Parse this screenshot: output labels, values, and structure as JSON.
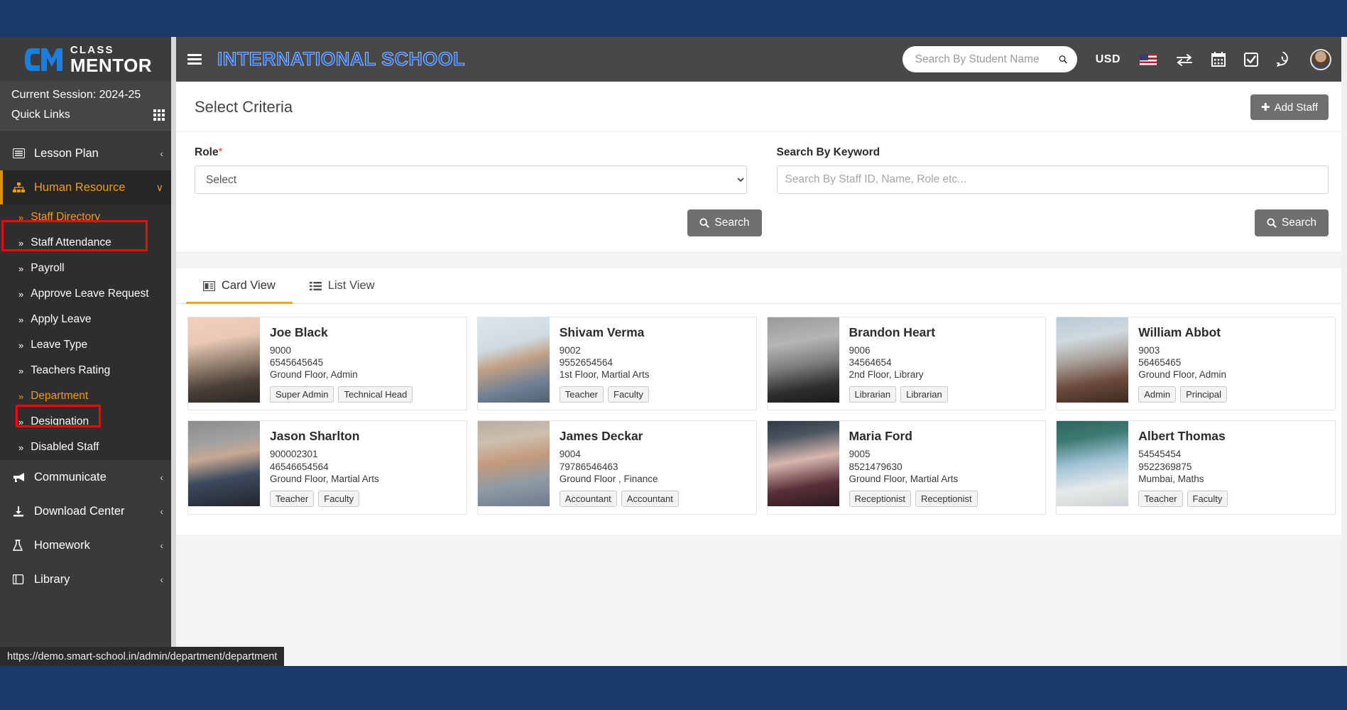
{
  "brand": {
    "top_word": "CLASS",
    "bottom_word": "MENTOR",
    "logo_icon": "cm-monogram-icon"
  },
  "sidebar": {
    "session_label": "Current Session: 2024-25",
    "quick_links_label": "Quick Links",
    "quick_links_icon": "grid-icon",
    "items": [
      {
        "label": "Lesson Plan",
        "icon": "lesson-plan-icon",
        "caret": "‹",
        "active": false
      },
      {
        "label": "Human Resource",
        "icon": "sitemap-icon",
        "caret": "∨",
        "active": true
      }
    ],
    "submenu": [
      {
        "label": "Staff Directory",
        "current": true
      },
      {
        "label": "Staff Attendance",
        "current": false
      },
      {
        "label": "Payroll",
        "current": false
      },
      {
        "label": "Approve Leave Request",
        "current": false
      },
      {
        "label": "Apply Leave",
        "current": false
      },
      {
        "label": "Leave Type",
        "current": false
      },
      {
        "label": "Teachers Rating",
        "current": false
      },
      {
        "label": "Department",
        "current": true
      },
      {
        "label": "Designation",
        "current": false
      },
      {
        "label": "Disabled Staff",
        "current": false
      }
    ],
    "items_after": [
      {
        "label": "Communicate",
        "icon": "megaphone-icon",
        "caret": "‹"
      },
      {
        "label": "Download Center",
        "icon": "download-icon",
        "caret": "‹"
      },
      {
        "label": "Homework",
        "icon": "flask-icon",
        "caret": "‹"
      },
      {
        "label": "Library",
        "icon": "book-icon",
        "caret": "‹"
      }
    ],
    "submenu_chevron": "»"
  },
  "topbar": {
    "menu_toggle_icon": "hamburger-icon",
    "school_title": "INTERNATIONAL SCHOOL",
    "search_placeholder": "Search By Student Name",
    "search_value": "",
    "search_icon": "search-icon",
    "currency_label": "USD",
    "flag_icon": "us-flag-icon",
    "transfer_icon": "exchange-icon",
    "calendar_icon": "calendar-icon",
    "checkbox_icon": "check-square-icon",
    "whatsapp_icon": "whatsapp-icon",
    "avatar_icon": "user-avatar"
  },
  "criteria": {
    "title": "Select Criteria",
    "add_staff_label": "Add Staff",
    "add_staff_icon": "plus-icon",
    "role_label": "Role",
    "role_required_mark": "*",
    "role_selected": "Select",
    "role_options": [
      "Select"
    ],
    "keyword_label": "Search By Keyword",
    "keyword_placeholder": "Search By Staff ID, Name, Role etc...",
    "keyword_value": "",
    "search_label": "Search",
    "search_icon": "search-icon"
  },
  "tabs": [
    {
      "label": "Card View",
      "icon": "card-view-icon",
      "active": true
    },
    {
      "label": "List View",
      "icon": "list-view-icon",
      "active": false
    }
  ],
  "staff": [
    {
      "name": "Joe Black",
      "staff_id": "9000",
      "phone": "6545645645",
      "location": "Ground Floor, Admin",
      "tags": [
        "Super Admin",
        "Technical Head"
      ],
      "photo": "joe-black-photo"
    },
    {
      "name": "Shivam Verma",
      "staff_id": "9002",
      "phone": "9552654564",
      "location": "1st Floor, Martial Arts",
      "tags": [
        "Teacher",
        "Faculty"
      ],
      "photo": "shivam-verma-photo"
    },
    {
      "name": "Brandon Heart",
      "staff_id": "9006",
      "phone": "34564654",
      "location": "2nd Floor, Library",
      "tags": [
        "Librarian",
        "Librarian"
      ],
      "photo": "brandon-heart-photo"
    },
    {
      "name": "William Abbot",
      "staff_id": "9003",
      "phone": "56465465",
      "location": "Ground Floor, Admin",
      "tags": [
        "Admin",
        "Principal"
      ],
      "photo": "william-abbot-photo"
    },
    {
      "name": "Jason Sharlton",
      "staff_id": "900002301",
      "phone": "46546654564",
      "location": "Ground Floor, Martial Arts",
      "tags": [
        "Teacher",
        "Faculty"
      ],
      "photo": "jason-sharlton-photo"
    },
    {
      "name": "James Deckar",
      "staff_id": "9004",
      "phone": "79786546463",
      "location": "Ground Floor , Finance",
      "tags": [
        "Accountant",
        "Accountant"
      ],
      "photo": "james-deckar-photo"
    },
    {
      "name": "Maria Ford",
      "staff_id": "9005",
      "phone": "8521479630",
      "location": "Ground Floor, Martial Arts",
      "tags": [
        "Receptionist",
        "Receptionist"
      ],
      "photo": "maria-ford-photo"
    },
    {
      "name": "Albert Thomas",
      "staff_id": "54545454",
      "phone": "9522369875",
      "location": "Mumbai, Maths",
      "tags": [
        "Teacher",
        "Faculty"
      ],
      "photo": "albert-thomas-photo"
    }
  ],
  "status_bar": {
    "url": "https://demo.smart-school.in/admin/department/department"
  },
  "colors": {
    "accent_orange": "#f39c12",
    "title_blue": "#1f5fd6",
    "sidebar_bg": "#3a3a3a",
    "chrome_blue": "#1b3a6b",
    "highlight_red": "#ff0000"
  }
}
